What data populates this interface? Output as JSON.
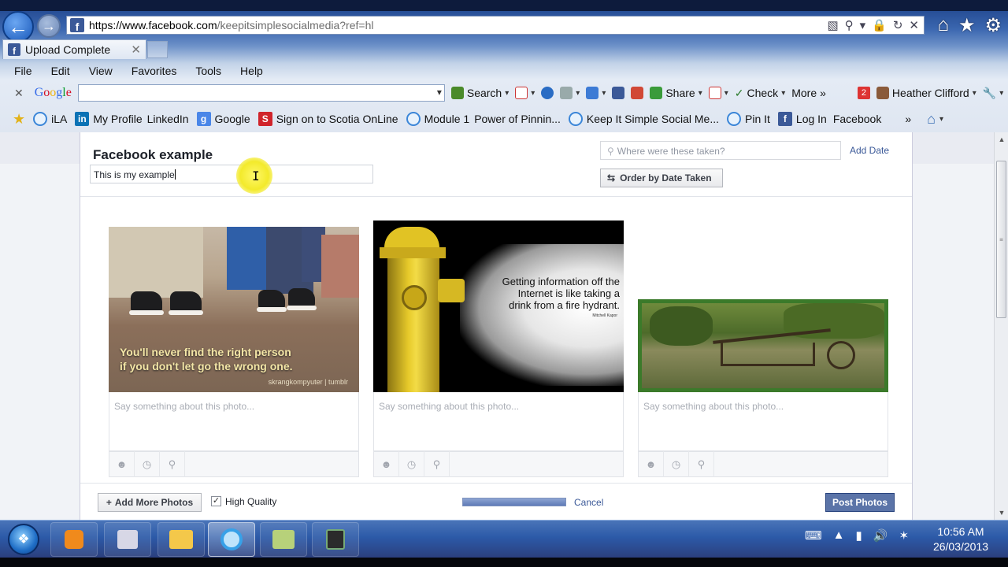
{
  "browser": {
    "url_host": "https://www.facebook.com",
    "url_rest": "/keepitsimplesocialmedia?ref=hl",
    "tab_title": "Upload Complete",
    "menu": [
      "File",
      "Edit",
      "View",
      "Favorites",
      "Tools",
      "Help"
    ],
    "google_toolbar": {
      "logo": "Google",
      "search_label": "Search",
      "share_label": "Share",
      "check_label": "Check",
      "more_label": "More",
      "badge_count": "2",
      "user_name": "Heather Clifford"
    },
    "favorites": [
      {
        "label": "iLA",
        "icon": "ie-icon"
      },
      {
        "label": "My Profile",
        "icon": "linkedin-icon"
      },
      {
        "label": "LinkedIn",
        "icon": "none"
      },
      {
        "label": "Google",
        "icon": "google-icon"
      },
      {
        "label": "Sign on to Scotia OnLine",
        "icon": "scotia-icon"
      },
      {
        "label": "Module 1",
        "icon": "ie-icon"
      },
      {
        "label": "Power of Pinnin...",
        "icon": "none"
      },
      {
        "label": "Keep It Simple Social Me...",
        "icon": "ie-icon"
      },
      {
        "label": "Pin It",
        "icon": "ie-icon"
      },
      {
        "label": "Log In",
        "icon": "facebook-icon"
      },
      {
        "label": "Facebook",
        "icon": "none"
      }
    ]
  },
  "upload_dialog": {
    "album_title": "Facebook example",
    "description_value": "This is my example",
    "location_placeholder": "Where were these taken?",
    "add_date_label": "Add Date",
    "order_button_label": "Order by Date Taken",
    "photos": [
      {
        "overlay_text_line1": "You'll never find the right person",
        "overlay_text_line2": "if you don't let go the wrong one.",
        "credit": "skrangkompyuter | tumblr",
        "caption_placeholder": "Say something about this photo..."
      },
      {
        "overlay_text_line1": "Getting information off the",
        "overlay_text_line2": "Internet is like taking a",
        "overlay_text_line3": "drink from a fire hydrant.",
        "credit": "Mitchell Kapor",
        "caption_placeholder": "Say something about this photo..."
      },
      {
        "caption_placeholder": "Say something about this photo..."
      }
    ],
    "add_more_label": "Add More Photos",
    "high_quality_label": "High Quality",
    "high_quality_checked": true,
    "upload_progress_fraction": 1.0,
    "cancel_label": "Cancel",
    "post_button_label": "Post Photos"
  },
  "taskbar": {
    "time": "10:56 AM",
    "date": "26/03/2013"
  },
  "colors": {
    "facebook_blue": "#3b5998",
    "post_button": "#5b74a8",
    "link": "#3b5998"
  }
}
